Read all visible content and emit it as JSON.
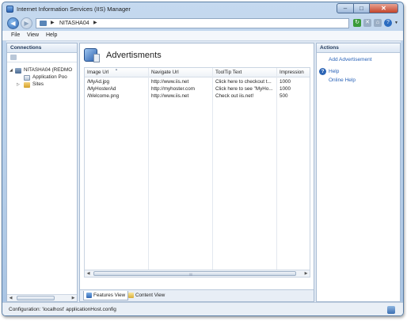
{
  "window": {
    "title": "Internet Information Services (IIS) Manager",
    "controls": {
      "minimize": "–",
      "maximize": "□",
      "close": "✕"
    }
  },
  "address_bar": {
    "back_glyph": "◀",
    "forward_glyph": "▶",
    "separator": "▶",
    "path": "NITASHA04",
    "path_arrow": "▶",
    "icons": [
      "refresh-icon",
      "stop-icon",
      "home-icon",
      "help-icon"
    ]
  },
  "menu": [
    "File",
    "View",
    "Help"
  ],
  "connections": {
    "header": "Connections",
    "tree": [
      {
        "label": "NITASHA04 (REDMO",
        "toggle": "◢",
        "icon": "server-icon"
      },
      {
        "label": "Application Poo",
        "toggle": "",
        "icon": "app-pool-icon"
      },
      {
        "label": "Sites",
        "toggle": "▷",
        "icon": "sites-folder-icon"
      }
    ],
    "scroll_left": "◀",
    "scroll_right": "▶"
  },
  "feature": {
    "title": "Advertisments",
    "columns": [
      "Image Url",
      "Navigate Url",
      "ToolTip Text",
      "Impression"
    ],
    "sort_indicator": "▲",
    "rows": [
      [
        "/MyAd.jpg",
        "http://www.iis.net",
        "Click here to checkout t...",
        "1000"
      ],
      [
        "/MyHosterAd",
        "http://myhoster.com",
        "Click here to see \"MyHo...",
        "1000"
      ],
      [
        "/Welcome.png",
        "http://www.iis.net",
        "Check out iis.net!",
        "500"
      ]
    ],
    "scroll_left": "◀",
    "scroll_right": "▶",
    "scroll_grip": "||||"
  },
  "view_tabs": {
    "features": "Features View",
    "content": "Content View"
  },
  "actions": {
    "header": "Actions",
    "items": [
      "Add Advertisement",
      "Help",
      "Online Help"
    ],
    "help_glyph": "?"
  },
  "status": {
    "text": "Configuration: 'localhost' applicationHost.config"
  },
  "colors": {
    "link": "#2a63b8",
    "frame": "#a9c4e3",
    "close_button": "#c4442b"
  }
}
